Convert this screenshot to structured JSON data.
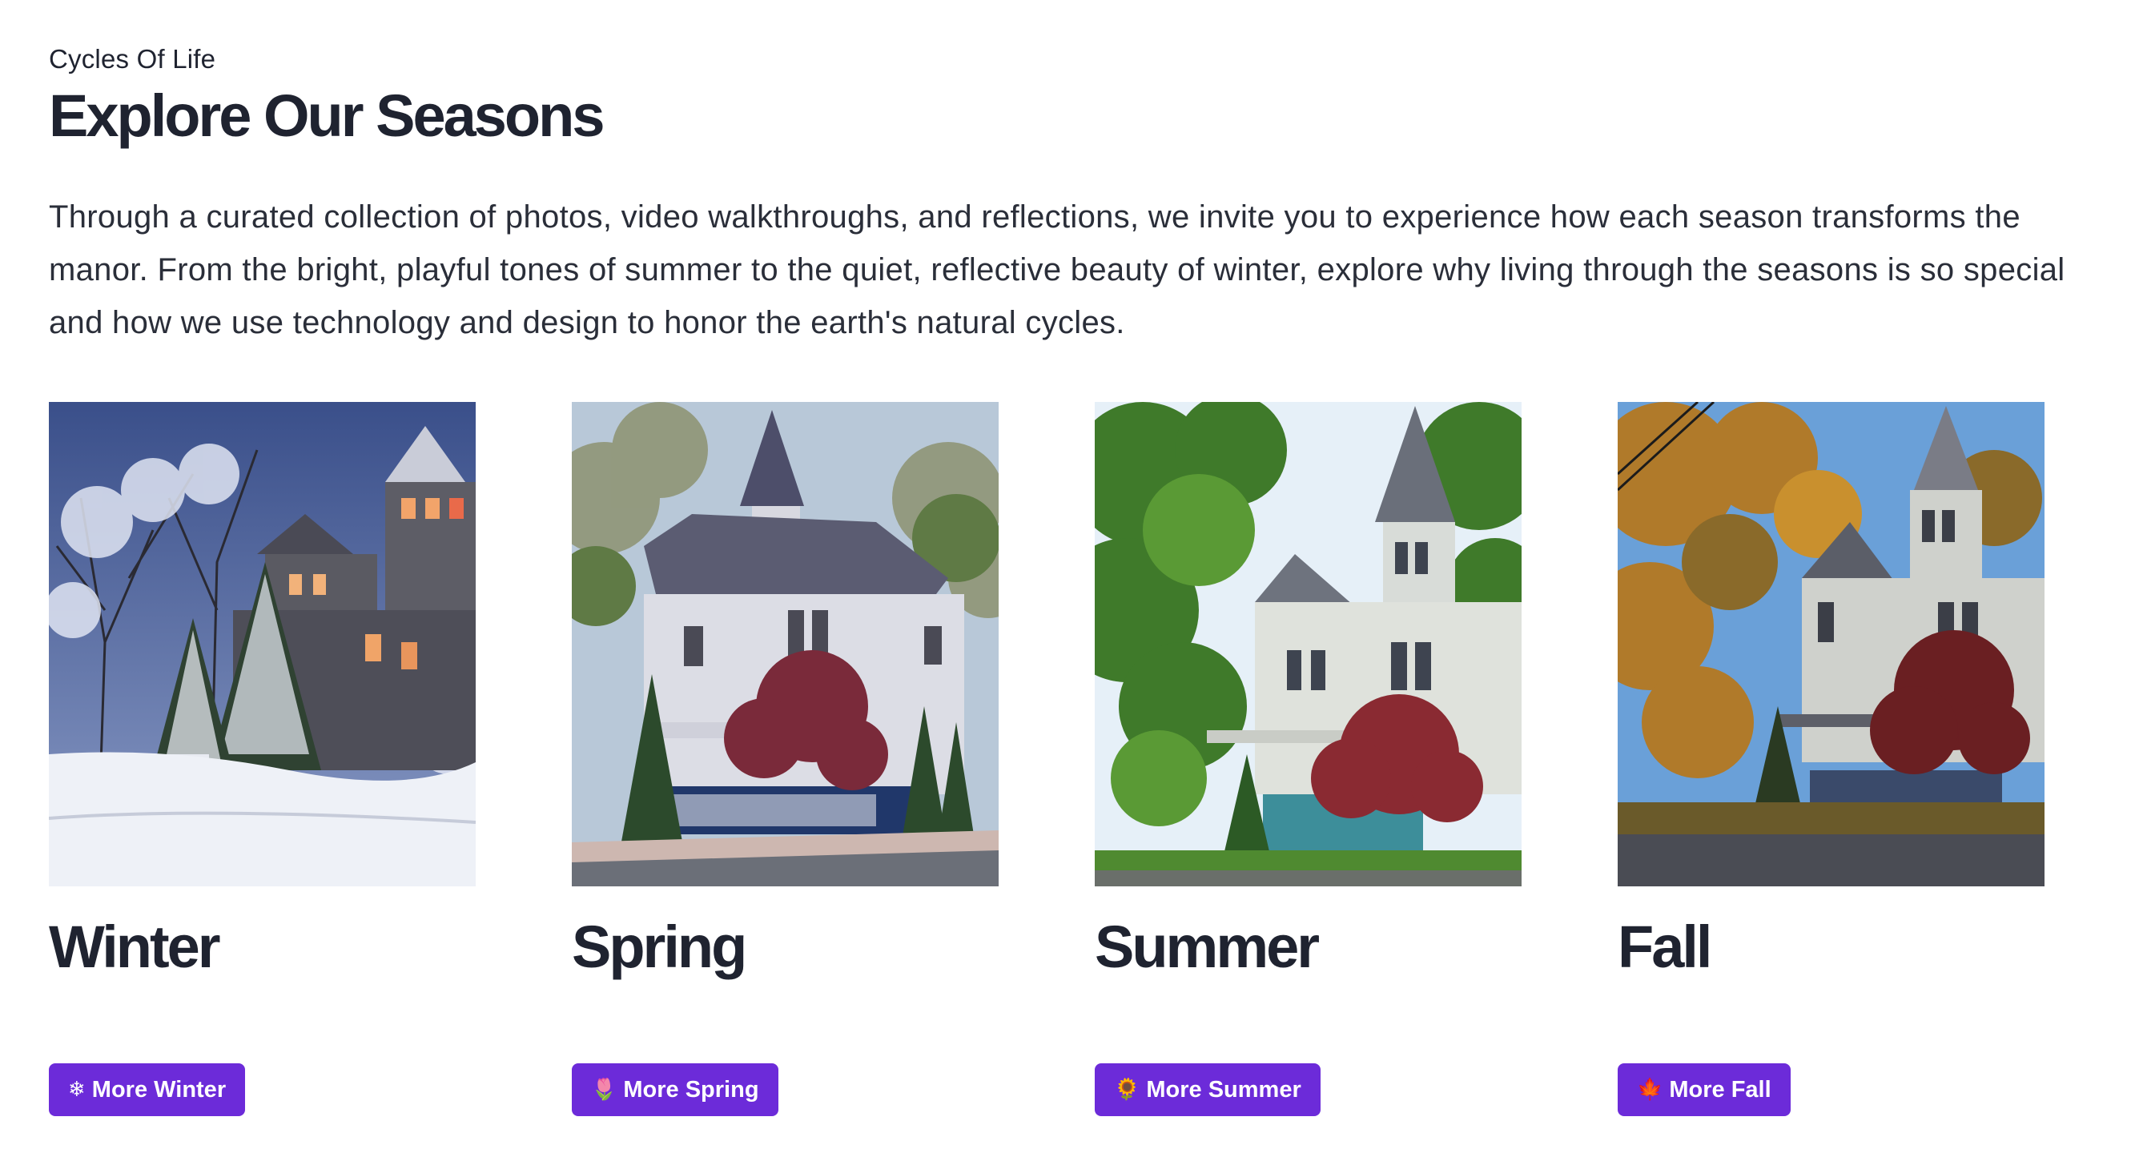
{
  "header": {
    "eyebrow": "Cycles Of Life",
    "title": "Explore Our Seasons"
  },
  "intro": {
    "text": "Through a curated collection of photos, video walkthroughs, and reflections, we invite you to experience how each season transforms the manor. From the bright, playful tones of summer to the quiet, reflective beauty of winter, explore why living through the seasons is so special and how we use technology and design to honor the earth's natural cycles."
  },
  "seasons": [
    {
      "name": "Winter",
      "button_label": "More Winter",
      "button_emoji": "❄",
      "icon": "snowflake-icon"
    },
    {
      "name": "Spring",
      "button_label": "More Spring",
      "button_emoji": "🌷",
      "icon": "tulip-icon"
    },
    {
      "name": "Summer",
      "button_label": "More Summer",
      "button_emoji": "🌻",
      "icon": "sunflower-icon"
    },
    {
      "name": "Fall",
      "button_label": "More Fall",
      "button_emoji": "🍁",
      "icon": "maple-leaf-icon"
    }
  ],
  "colors": {
    "accent": "#6c2bd9",
    "text": "#1f2330"
  }
}
